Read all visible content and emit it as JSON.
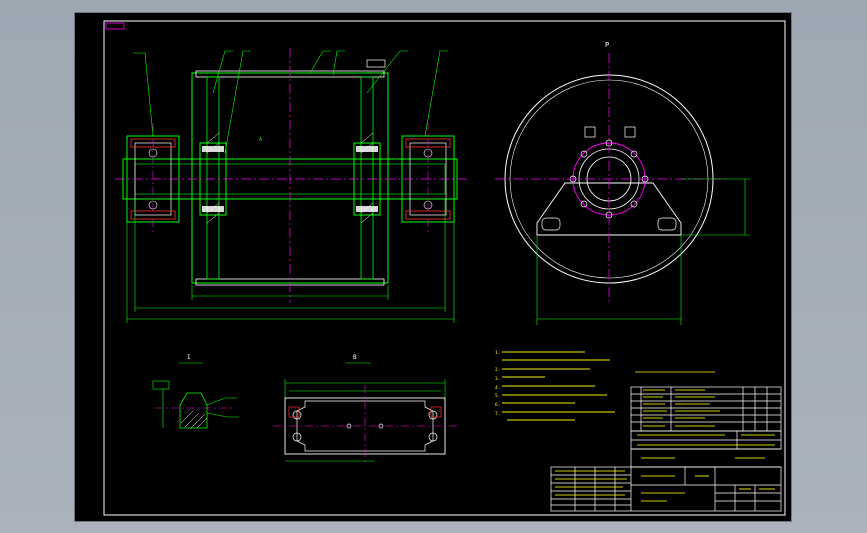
{
  "drawing": {
    "labels": {
      "top_tag": "",
      "view_p": "P",
      "section_a": "A",
      "detail_i": "I",
      "view_b": "B"
    },
    "tech_requirements": {
      "title": "",
      "lines": [
        "1.",
        "2.",
        "3.",
        "4.",
        "5.",
        "6.",
        "7."
      ]
    },
    "note_top": "",
    "title_block": {
      "main_title": "",
      "drawing_no": "",
      "scale": "",
      "sheet": "",
      "company": ""
    },
    "colors": {
      "background": "#000000",
      "frame": "#ffffff",
      "outline": "#00ff00",
      "centerline": "#ff00ff",
      "hatch": "#ffffff",
      "part_line": "#ffffff",
      "dimension": "#00ff00",
      "leader": "#00ff00",
      "highlight_red": "#ff3030"
    }
  }
}
